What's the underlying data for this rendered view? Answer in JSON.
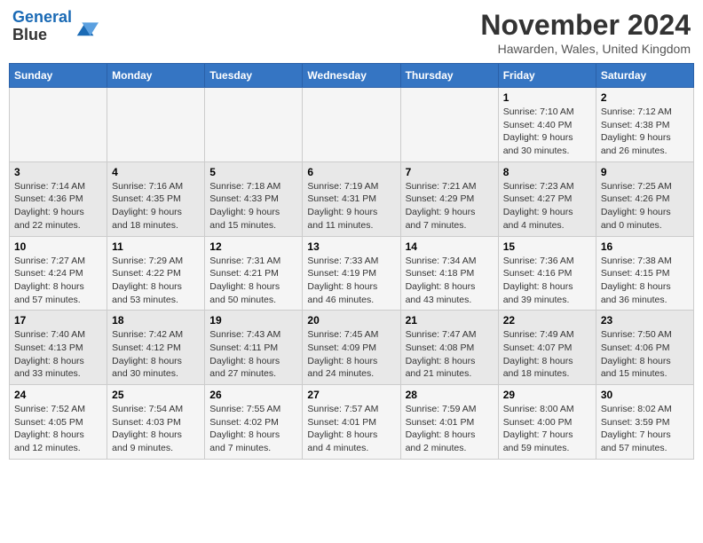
{
  "header": {
    "logo_line1": "General",
    "logo_line2": "Blue",
    "title": "November 2024",
    "subtitle": "Hawarden, Wales, United Kingdom"
  },
  "weekdays": [
    "Sunday",
    "Monday",
    "Tuesday",
    "Wednesday",
    "Thursday",
    "Friday",
    "Saturday"
  ],
  "weeks": [
    [
      {
        "day": "",
        "info": ""
      },
      {
        "day": "",
        "info": ""
      },
      {
        "day": "",
        "info": ""
      },
      {
        "day": "",
        "info": ""
      },
      {
        "day": "",
        "info": ""
      },
      {
        "day": "1",
        "info": "Sunrise: 7:10 AM\nSunset: 4:40 PM\nDaylight: 9 hours and 30 minutes."
      },
      {
        "day": "2",
        "info": "Sunrise: 7:12 AM\nSunset: 4:38 PM\nDaylight: 9 hours and 26 minutes."
      }
    ],
    [
      {
        "day": "3",
        "info": "Sunrise: 7:14 AM\nSunset: 4:36 PM\nDaylight: 9 hours and 22 minutes."
      },
      {
        "day": "4",
        "info": "Sunrise: 7:16 AM\nSunset: 4:35 PM\nDaylight: 9 hours and 18 minutes."
      },
      {
        "day": "5",
        "info": "Sunrise: 7:18 AM\nSunset: 4:33 PM\nDaylight: 9 hours and 15 minutes."
      },
      {
        "day": "6",
        "info": "Sunrise: 7:19 AM\nSunset: 4:31 PM\nDaylight: 9 hours and 11 minutes."
      },
      {
        "day": "7",
        "info": "Sunrise: 7:21 AM\nSunset: 4:29 PM\nDaylight: 9 hours and 7 minutes."
      },
      {
        "day": "8",
        "info": "Sunrise: 7:23 AM\nSunset: 4:27 PM\nDaylight: 9 hours and 4 minutes."
      },
      {
        "day": "9",
        "info": "Sunrise: 7:25 AM\nSunset: 4:26 PM\nDaylight: 9 hours and 0 minutes."
      }
    ],
    [
      {
        "day": "10",
        "info": "Sunrise: 7:27 AM\nSunset: 4:24 PM\nDaylight: 8 hours and 57 minutes."
      },
      {
        "day": "11",
        "info": "Sunrise: 7:29 AM\nSunset: 4:22 PM\nDaylight: 8 hours and 53 minutes."
      },
      {
        "day": "12",
        "info": "Sunrise: 7:31 AM\nSunset: 4:21 PM\nDaylight: 8 hours and 50 minutes."
      },
      {
        "day": "13",
        "info": "Sunrise: 7:33 AM\nSunset: 4:19 PM\nDaylight: 8 hours and 46 minutes."
      },
      {
        "day": "14",
        "info": "Sunrise: 7:34 AM\nSunset: 4:18 PM\nDaylight: 8 hours and 43 minutes."
      },
      {
        "day": "15",
        "info": "Sunrise: 7:36 AM\nSunset: 4:16 PM\nDaylight: 8 hours and 39 minutes."
      },
      {
        "day": "16",
        "info": "Sunrise: 7:38 AM\nSunset: 4:15 PM\nDaylight: 8 hours and 36 minutes."
      }
    ],
    [
      {
        "day": "17",
        "info": "Sunrise: 7:40 AM\nSunset: 4:13 PM\nDaylight: 8 hours and 33 minutes."
      },
      {
        "day": "18",
        "info": "Sunrise: 7:42 AM\nSunset: 4:12 PM\nDaylight: 8 hours and 30 minutes."
      },
      {
        "day": "19",
        "info": "Sunrise: 7:43 AM\nSunset: 4:11 PM\nDaylight: 8 hours and 27 minutes."
      },
      {
        "day": "20",
        "info": "Sunrise: 7:45 AM\nSunset: 4:09 PM\nDaylight: 8 hours and 24 minutes."
      },
      {
        "day": "21",
        "info": "Sunrise: 7:47 AM\nSunset: 4:08 PM\nDaylight: 8 hours and 21 minutes."
      },
      {
        "day": "22",
        "info": "Sunrise: 7:49 AM\nSunset: 4:07 PM\nDaylight: 8 hours and 18 minutes."
      },
      {
        "day": "23",
        "info": "Sunrise: 7:50 AM\nSunset: 4:06 PM\nDaylight: 8 hours and 15 minutes."
      }
    ],
    [
      {
        "day": "24",
        "info": "Sunrise: 7:52 AM\nSunset: 4:05 PM\nDaylight: 8 hours and 12 minutes."
      },
      {
        "day": "25",
        "info": "Sunrise: 7:54 AM\nSunset: 4:03 PM\nDaylight: 8 hours and 9 minutes."
      },
      {
        "day": "26",
        "info": "Sunrise: 7:55 AM\nSunset: 4:02 PM\nDaylight: 8 hours and 7 minutes."
      },
      {
        "day": "27",
        "info": "Sunrise: 7:57 AM\nSunset: 4:01 PM\nDaylight: 8 hours and 4 minutes."
      },
      {
        "day": "28",
        "info": "Sunrise: 7:59 AM\nSunset: 4:01 PM\nDaylight: 8 hours and 2 minutes."
      },
      {
        "day": "29",
        "info": "Sunrise: 8:00 AM\nSunset: 4:00 PM\nDaylight: 7 hours and 59 minutes."
      },
      {
        "day": "30",
        "info": "Sunrise: 8:02 AM\nSunset: 3:59 PM\nDaylight: 7 hours and 57 minutes."
      }
    ]
  ]
}
